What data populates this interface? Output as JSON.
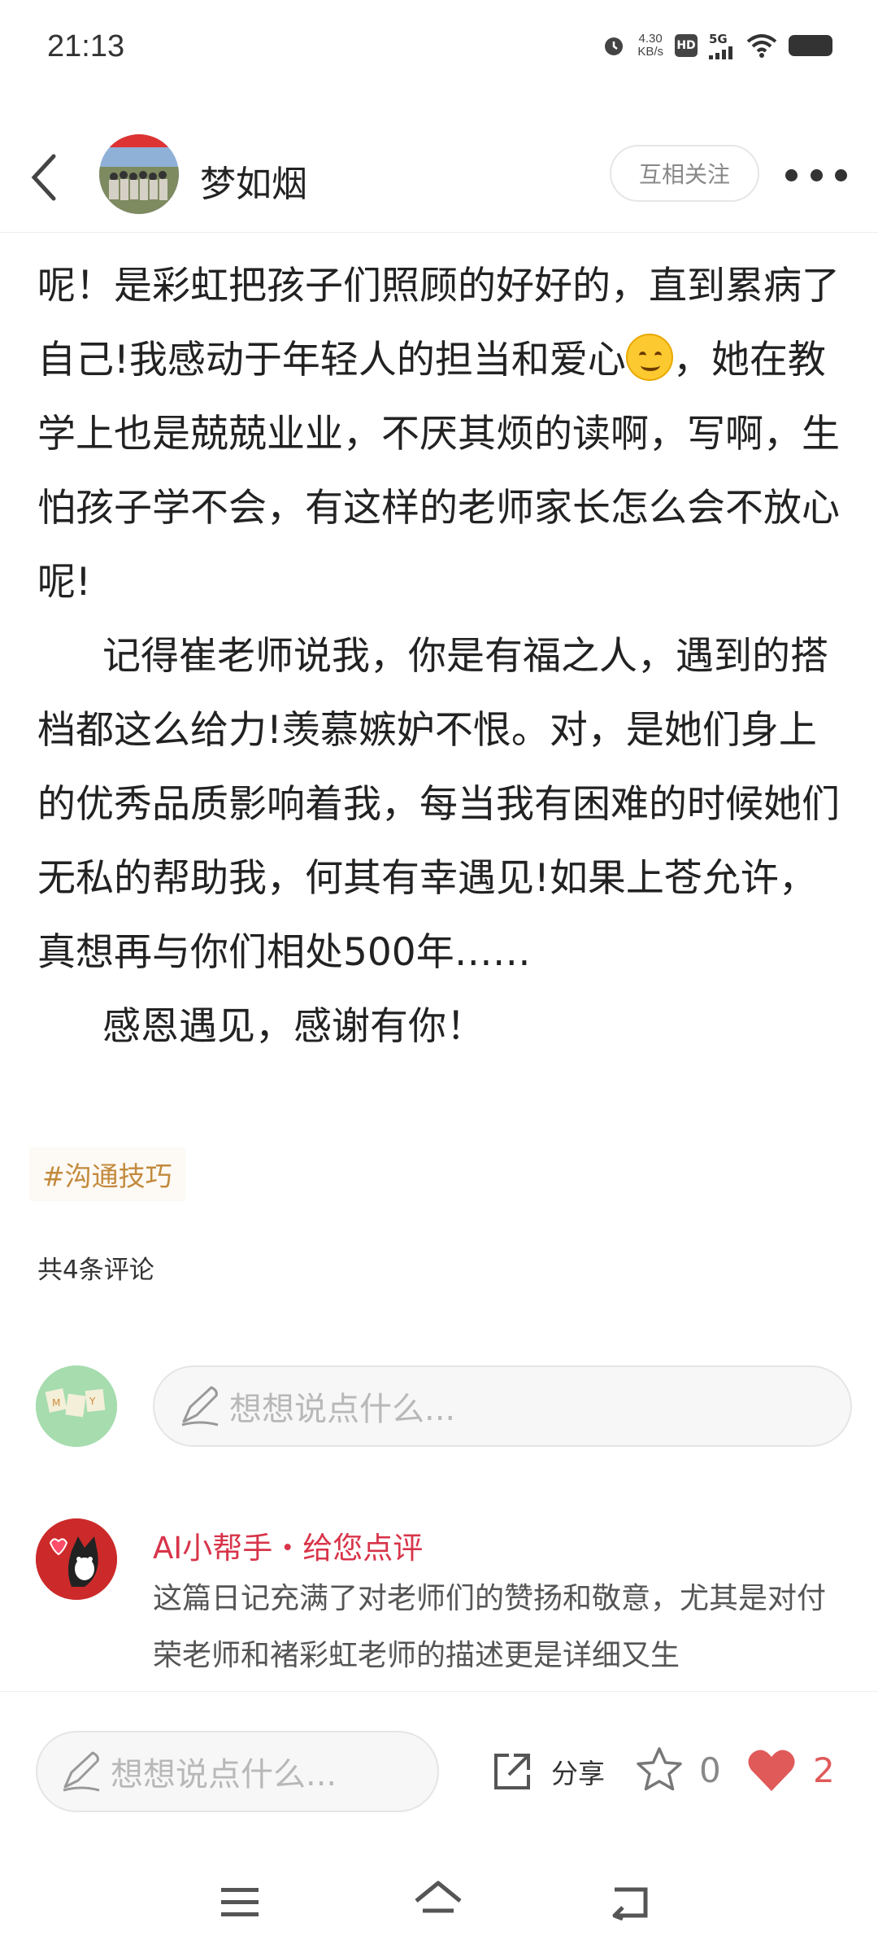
{
  "status_bar": {
    "time": "21:13",
    "net_speed_value": "4.30",
    "net_speed_unit": "KB/s",
    "hd": "HD",
    "network": "5G"
  },
  "header": {
    "author_name": "梦如烟",
    "follow_label": "互相关注"
  },
  "article": {
    "paragraph_1a": "呢！是彩虹把孩子们照顾的好好的，直到累病了自己!我感动于年轻人的担当和爱心",
    "paragraph_1b": "，她在教学上也是兢兢业业，不厌其烦的读啊，写啊，生怕孩子学不会，有这样的老师家长怎么会不放心呢!",
    "paragraph_2": "记得崔老师说我，你是有福之人，遇到的搭档都这么给力!羡慕嫉妒不恨。对，是她们身上的优秀品质影响着我，每当我有困难的时候她们无私的帮助我，何其有幸遇见!如果上苍允许，真想再与你们相处500年……",
    "paragraph_3": "感恩遇见，感谢有你！"
  },
  "tag": "#沟通技巧",
  "comment_count": "共4条评论",
  "comment_input_placeholder": "想想说点什么...",
  "ai_comment": {
    "title": "AI小帮手・给您点评",
    "text": "这篇日记充满了对老师们的赞扬和敬意，尤其是对付荣老师和褚彩虹老师的描述更是详细又生"
  },
  "bottom_bar": {
    "input_placeholder": "想想说点什么...",
    "share_label": "分享",
    "favorite_count": "0",
    "like_count": "2"
  },
  "colors": {
    "accent_red": "#d8344a",
    "like_red": "#e05a5a",
    "tag_color": "#c28a3c"
  }
}
